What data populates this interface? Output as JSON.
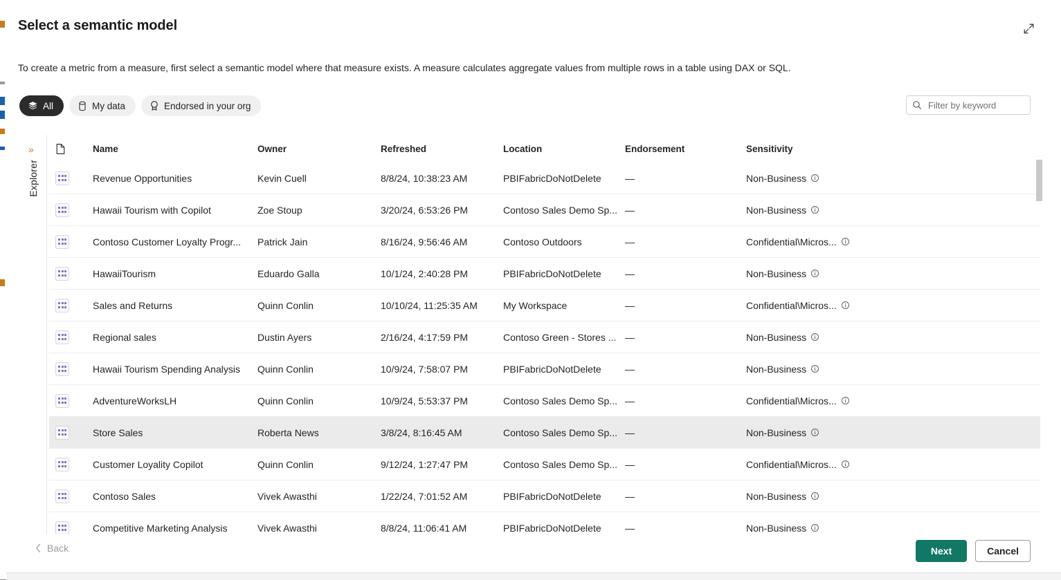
{
  "dialog": {
    "title": "Select a semantic model",
    "description": "To create a metric from a measure, first select a semantic model where that measure exists. A measure calculates aggregate values from multiple rows in a table using DAX or SQL.",
    "expand_icon": "expand-diagonal-icon"
  },
  "explorer": {
    "label": "Explorer",
    "chevron": "»"
  },
  "filters": {
    "pills": [
      {
        "label": "All",
        "icon": "layers-stack-icon",
        "active": true
      },
      {
        "label": "My data",
        "icon": "database-cylinder-icon",
        "active": false
      },
      {
        "label": "Endorsed in your org",
        "icon": "award-badge-icon",
        "active": false
      }
    ]
  },
  "search": {
    "placeholder": "Filter by keyword",
    "value": "",
    "icon": "search-icon"
  },
  "table": {
    "columns": [
      "",
      "Name",
      "Owner",
      "Refreshed",
      "Location",
      "Endorsement",
      "Sensitivity"
    ],
    "header_icon": "document-icon",
    "row_icon": "semantic-model-icon",
    "sensitivity_info_icon": "info-circle-icon",
    "rows": [
      {
        "name": "Revenue Opportunities",
        "owner": "Kevin Cuell",
        "refreshed": "8/8/24, 10:38:23 AM",
        "location": "PBIFabricDoNotDelete",
        "endorsement": "—",
        "sensitivity": "Non-Business",
        "selected": false
      },
      {
        "name": "Hawaii Tourism with Copilot",
        "owner": "Zoe Stoup",
        "refreshed": "3/20/24, 6:53:26 PM",
        "location": "Contoso Sales Demo Sp...",
        "endorsement": "—",
        "sensitivity": "Non-Business",
        "selected": false
      },
      {
        "name": "Contoso Customer Loyalty Progr...",
        "owner": "Patrick Jain",
        "refreshed": "8/16/24, 9:56:46 AM",
        "location": "Contoso Outdoors",
        "endorsement": "—",
        "sensitivity": "Confidential\\Micros...",
        "selected": false
      },
      {
        "name": "HawaiiTourism",
        "owner": "Eduardo Galla",
        "refreshed": "10/1/24, 2:40:28 PM",
        "location": "PBIFabricDoNotDelete",
        "endorsement": "—",
        "sensitivity": "Non-Business",
        "selected": false
      },
      {
        "name": "Sales and Returns",
        "owner": "Quinn Conlin",
        "refreshed": "10/10/24, 11:25:35 AM",
        "location": "My Workspace",
        "endorsement": "—",
        "sensitivity": "Confidential\\Micros...",
        "selected": false
      },
      {
        "name": "Regional sales",
        "owner": "Dustin Ayers",
        "refreshed": "2/16/24, 4:17:59 PM",
        "location": "Contoso Green - Stores ...",
        "endorsement": "—",
        "sensitivity": "Non-Business",
        "selected": false
      },
      {
        "name": "Hawaii Tourism Spending Analysis",
        "owner": "Quinn Conlin",
        "refreshed": "10/9/24, 7:58:07 PM",
        "location": "PBIFabricDoNotDelete",
        "endorsement": "—",
        "sensitivity": "Non-Business",
        "selected": false
      },
      {
        "name": "AdventureWorksLH",
        "owner": "Quinn Conlin",
        "refreshed": "10/9/24, 5:53:37 PM",
        "location": "Contoso Sales Demo Sp...",
        "endorsement": "—",
        "sensitivity": "Confidential\\Micros...",
        "selected": false
      },
      {
        "name": "Store Sales",
        "owner": "Roberta News",
        "refreshed": "3/8/24, 8:16:45 AM",
        "location": "Contoso Sales Demo Sp...",
        "endorsement": "—",
        "sensitivity": "Non-Business",
        "selected": true
      },
      {
        "name": "Customer Loyality Copilot",
        "owner": "Quinn Conlin",
        "refreshed": "9/12/24, 1:27:47 PM",
        "location": "Contoso Sales Demo Sp...",
        "endorsement": "—",
        "sensitivity": "Confidential\\Micros...",
        "selected": false
      },
      {
        "name": "Contoso Sales",
        "owner": "Vivek Awasthi",
        "refreshed": "1/22/24, 7:01:52 AM",
        "location": "PBIFabricDoNotDelete",
        "endorsement": "—",
        "sensitivity": "Non-Business",
        "selected": false
      },
      {
        "name": "Competitive Marketing Analysis",
        "owner": "Vivek Awasthi",
        "refreshed": "8/8/24, 11:06:41 AM",
        "location": "PBIFabricDoNotDelete",
        "endorsement": "—",
        "sensitivity": "Non-Business",
        "selected": false
      }
    ]
  },
  "footer": {
    "back_label": "Back",
    "back_icon": "chevron-left-icon",
    "next_label": "Next",
    "cancel_label": "Cancel"
  },
  "colors": {
    "primary_button": "#117865",
    "active_pill": "#2b2b2b",
    "model_icon_dot": "#8661c5",
    "explorer_chevron": "#c77b1e",
    "selected_row": "#ebebeb"
  }
}
